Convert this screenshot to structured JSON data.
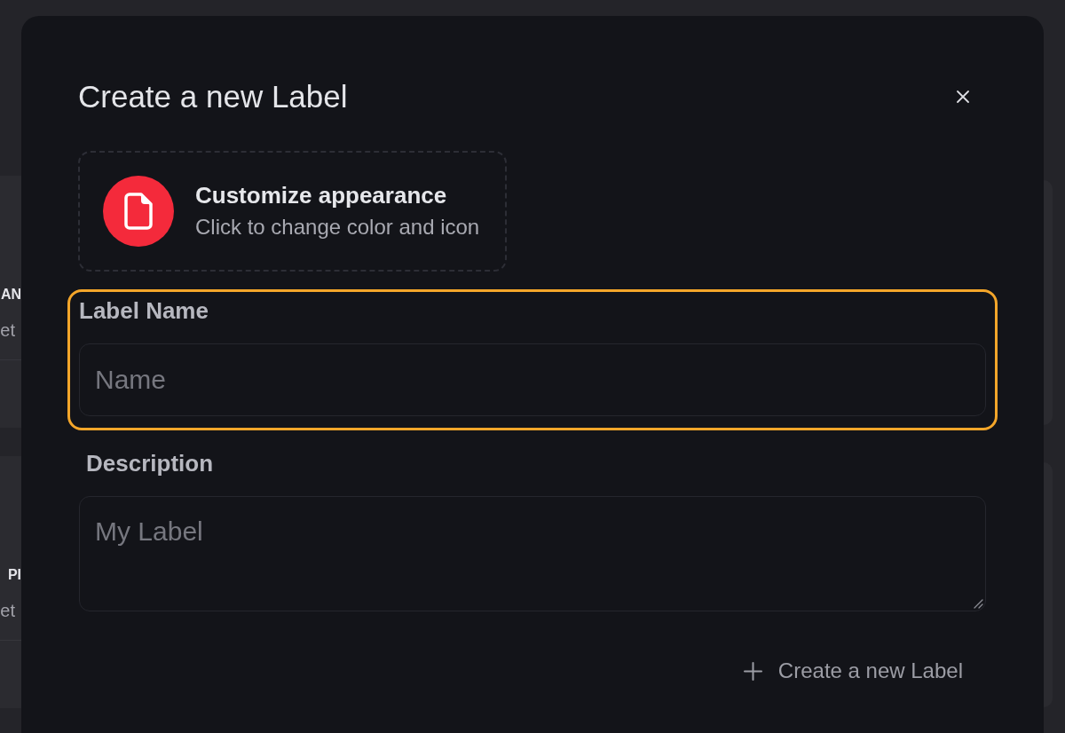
{
  "background_cards": [
    {
      "title": "AN",
      "subtitle": "et"
    },
    {
      "title": "PI",
      "subtitle": "et"
    }
  ],
  "dialog": {
    "title": "Create a new Label"
  },
  "appearance": {
    "title": "Customize appearance",
    "hint": "Click to change color and icon"
  },
  "fields": [
    {
      "kind": "input",
      "label": "Label Name",
      "placeholder": "Name",
      "highlighted": true
    },
    {
      "kind": "textarea",
      "label": "Description",
      "placeholder": "My Label",
      "highlighted": false
    }
  ],
  "submit": {
    "label": "Create a new Label"
  }
}
